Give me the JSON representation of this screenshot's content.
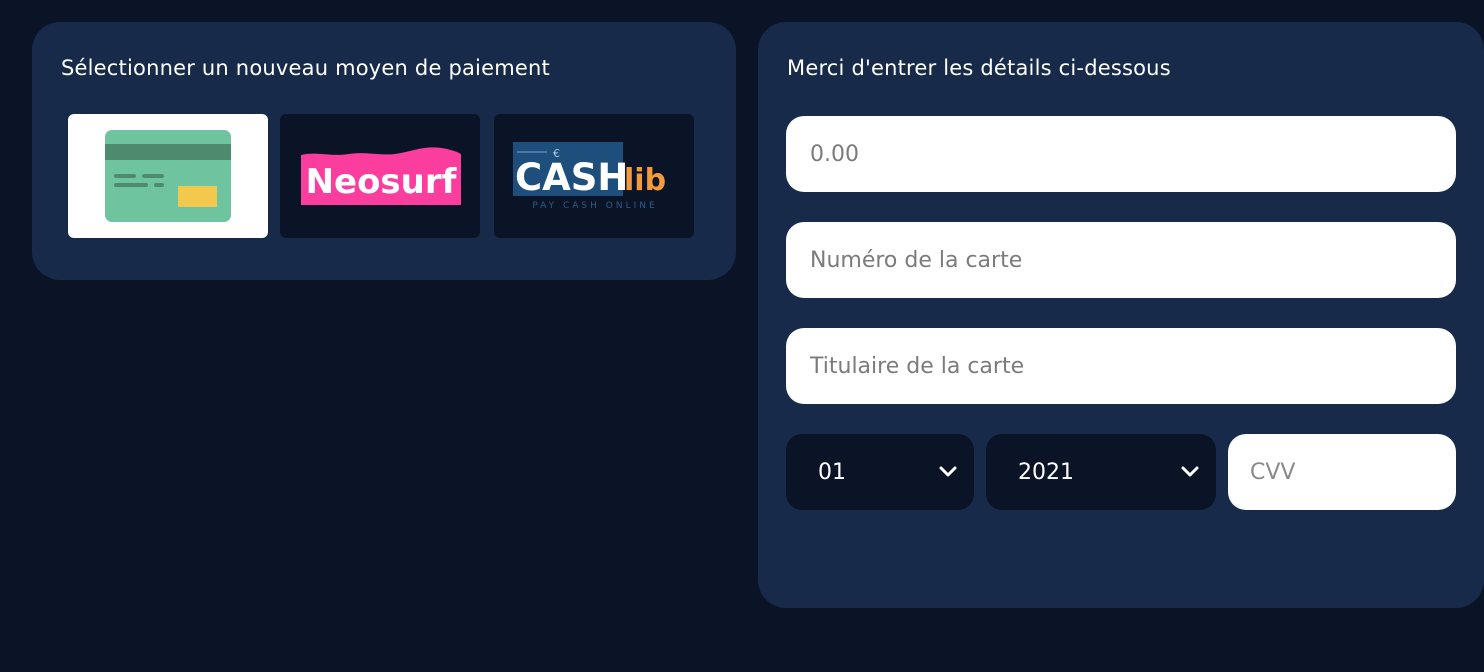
{
  "methods_panel": {
    "title": "Sélectionner un nouveau moyen de paiement",
    "options": [
      {
        "icon": "credit-card-icon",
        "selected": true
      },
      {
        "icon": "neosurf-logo",
        "logo_text": "Neosurf",
        "selected": false
      },
      {
        "icon": "cashlib-logo",
        "logo_text": "CASHlib",
        "logo_tagline": "PAY CASH ONLINE",
        "selected": false
      }
    ]
  },
  "details_panel": {
    "title": "Merci d'entrer les détails ci-dessous",
    "amount_placeholder": "0.00",
    "card_number_placeholder": "Numéro de la carte",
    "cardholder_placeholder": "Titulaire de la carte",
    "month_value": "01",
    "year_value": "2021",
    "cvv_placeholder": "CVV"
  },
  "colors": {
    "background": "#0b1426",
    "panel": "#172a4a",
    "card_green": "#6fc4a0",
    "card_stripe": "#4e8b6e",
    "card_chip": "#f2c94c",
    "neosurf_pink": "#fb3d9e",
    "cashlib_blue": "#1d4e7c",
    "cashlib_orange": "#f39a3d"
  }
}
